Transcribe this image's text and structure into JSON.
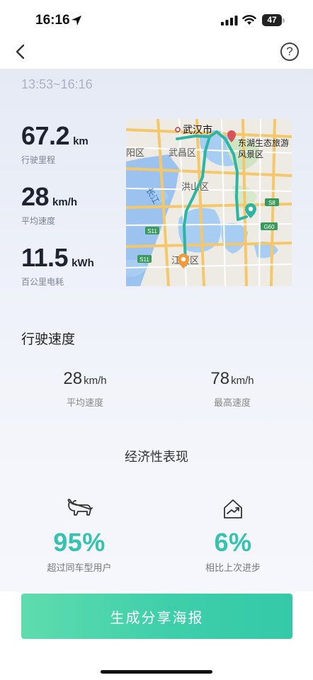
{
  "status_bar": {
    "time": "16:16",
    "battery": "47"
  },
  "nav": {
    "help_glyph": "?"
  },
  "trip": {
    "time_range": "13:53~16:16",
    "stats": [
      {
        "value": "67.2",
        "unit": "km",
        "label": "行驶里程"
      },
      {
        "value": "28",
        "unit": "km/h",
        "label": "平均速度"
      },
      {
        "value": "11.5",
        "unit": "kWh",
        "label": "百公里电耗"
      }
    ]
  },
  "map": {
    "labels": {
      "city": "武汉市",
      "wuchang": "武昌区",
      "hongshan": "洪山区",
      "hanyang": "阳区",
      "jiangxia": "江夏区",
      "river": "长江",
      "donghu_line1": "东湖生态旅游",
      "donghu_line2": "风景区"
    },
    "road_shields": [
      "S8",
      "G60",
      "S11",
      "S11"
    ],
    "route_color": "#2cb5a3"
  },
  "speed_section": {
    "title": "行驶速度",
    "items": [
      {
        "value": "28",
        "unit": "km/h",
        "label": "平均速度"
      },
      {
        "value": "78",
        "unit": "km/h",
        "label": "最高速度"
      }
    ]
  },
  "economy_section": {
    "title": "经济性表现",
    "items": [
      {
        "icon": "bull-icon",
        "value": "95%",
        "label": "超过同车型用户"
      },
      {
        "icon": "trend-up-home-icon",
        "value": "6%",
        "label": "相比上次进步"
      }
    ],
    "accent_color": "#34c3ae"
  },
  "action": {
    "generate_label": "生成分享海报"
  }
}
